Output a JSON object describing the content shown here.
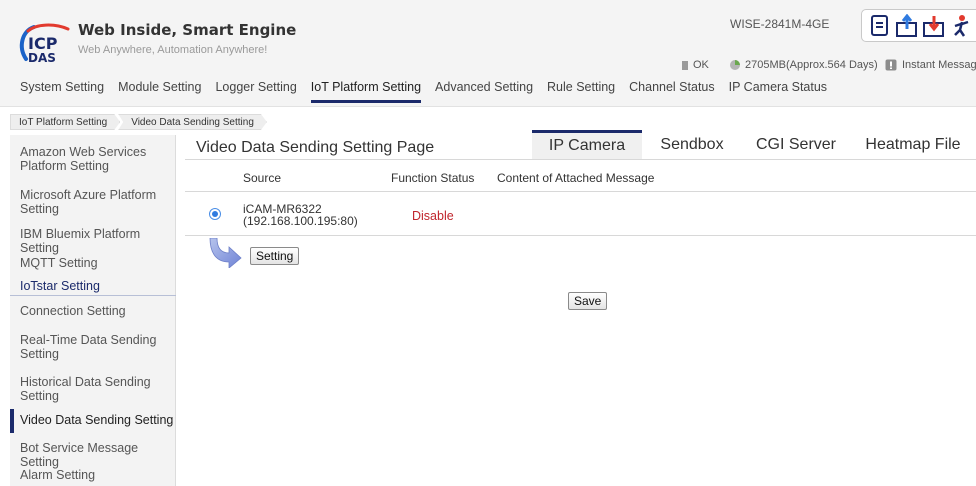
{
  "brand": {
    "title": "Web Inside, Smart Engine",
    "subtitle": "Web Anywhere, Automation Anywhere!",
    "logo_text_top": "ICP",
    "logo_text_bottom": "DAS"
  },
  "device": {
    "model": "WISE-2841M-4GE"
  },
  "top_icons": [
    "document-icon",
    "upload-icon",
    "download-icon",
    "logout-icon"
  ],
  "status": {
    "ok_label": "OK",
    "storage": "2705MB(Approx.564 Days)",
    "instant_message": "Instant Message"
  },
  "nav": {
    "items": [
      "System Setting",
      "Module Setting",
      "Logger Setting",
      "IoT Platform Setting",
      "Advanced Setting",
      "Rule Setting",
      "Channel Status",
      "IP Camera Status"
    ],
    "active": "IoT Platform Setting"
  },
  "breadcrumb": [
    "IoT Platform Setting",
    "Video Data Sending Setting"
  ],
  "sidebar": {
    "items": [
      "Amazon Web Services Platform Setting",
      "Microsoft Azure Platform Setting",
      "IBM Bluemix Platform Setting",
      "MQTT Setting",
      "IoTstar Setting",
      "Connection Setting",
      "Real-Time Data Sending Setting",
      "Historical Data Sending Setting",
      "Video Data Sending Setting",
      "Bot Service Message Setting",
      "Alarm Setting"
    ],
    "active": "Video Data Sending Setting"
  },
  "page": {
    "title": "Video Data Sending Setting Page"
  },
  "tabs": {
    "items": [
      "IP Camera",
      "Sendbox",
      "CGI Server",
      "Heatmap File"
    ],
    "active": "IP Camera"
  },
  "table": {
    "columns": [
      "Source",
      "Function Status",
      "Content of Attached Message"
    ],
    "rows": [
      {
        "name": "iCAM-MR6322",
        "address": "(192.168.100.195:80)",
        "status": "Disable",
        "message": "",
        "selected": true
      }
    ]
  },
  "buttons": {
    "setting": "Setting",
    "save": "Save"
  },
  "colors": {
    "accent": "#1b2a6b",
    "disable_red": "#c0262d",
    "radio_blue": "#2f7be0"
  }
}
